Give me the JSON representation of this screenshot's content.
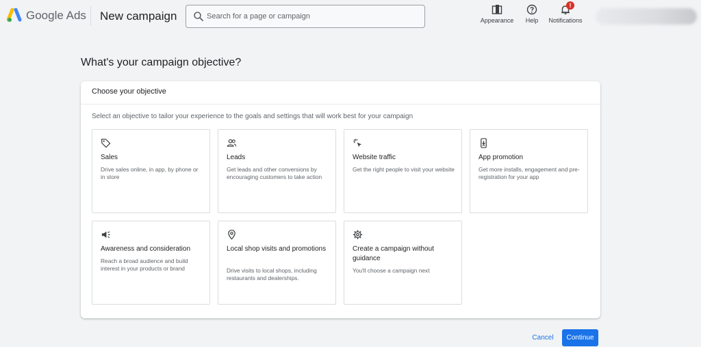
{
  "header": {
    "brand": "Google Ads",
    "page_title": "New campaign",
    "search_placeholder": "Search for a page or campaign",
    "search_value": "",
    "tools": [
      {
        "label": "Appearance",
        "icon": "appearance-icon"
      },
      {
        "label": "Help",
        "icon": "help-icon"
      },
      {
        "label": "Notifications",
        "icon": "bell-icon",
        "badge": "!"
      }
    ]
  },
  "main": {
    "title": "What's your campaign objective?",
    "card_title": "Choose your objective",
    "description": "Select an objective to tailor your experience to the goals and settings that will work best for your campaign",
    "objectives": [
      {
        "title": "Sales",
        "description": "Drive sales online, in app, by phone or in store",
        "icon": "tag-icon"
      },
      {
        "title": "Leads",
        "description": "Get leads and other conversions by encouraging customers to take action",
        "icon": "people-icon"
      },
      {
        "title": "Website traffic",
        "description": "Get the right people to visit your website",
        "icon": "cursor-click-icon"
      },
      {
        "title": "App promotion",
        "description": "Get more installs, engagement and pre-registration for your app",
        "icon": "phone-download-icon"
      },
      {
        "title": "Awareness and consideration",
        "description": "Reach a broad audience and build interest in your products or brand",
        "icon": "megaphone-icon"
      },
      {
        "title": "Local shop visits and promotions",
        "description": "Drive visits to local shops, including restaurants and dealerships.",
        "icon": "location-pin-icon"
      },
      {
        "title": "Create a campaign without guidance",
        "description": "You'll choose a campaign next",
        "icon": "gear-icon"
      }
    ]
  },
  "footer": {
    "cancel_label": "Cancel",
    "continue_label": "Continue"
  },
  "colors": {
    "accent": "#1a73e8",
    "badge": "#d93025",
    "background": "#f1f3f4"
  }
}
